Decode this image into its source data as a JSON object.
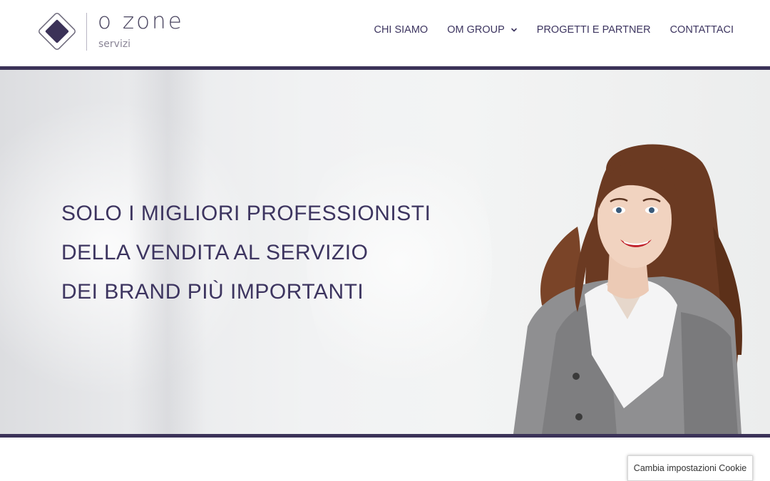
{
  "brand": {
    "name": "o zone",
    "subtitle": "servizi",
    "accent_color": "#3b3258"
  },
  "nav": {
    "items": [
      {
        "label": "CHI SIAMO",
        "has_dropdown": false
      },
      {
        "label": "OM GROUP",
        "has_dropdown": true,
        "icon": "chevron-down-icon"
      },
      {
        "label": "PROGETTI E PARTNER",
        "has_dropdown": false
      },
      {
        "label": "CONTATTACI",
        "has_dropdown": false
      }
    ]
  },
  "hero": {
    "headline_lines": [
      "SOLO I MIGLIORI PROFESSIONISTI",
      "DELLA VENDITA AL SERVIZIO",
      "DEI BRAND PIÙ IMPORTANTI"
    ]
  },
  "cookie": {
    "label": "Cambia impostazioni Cookie"
  }
}
